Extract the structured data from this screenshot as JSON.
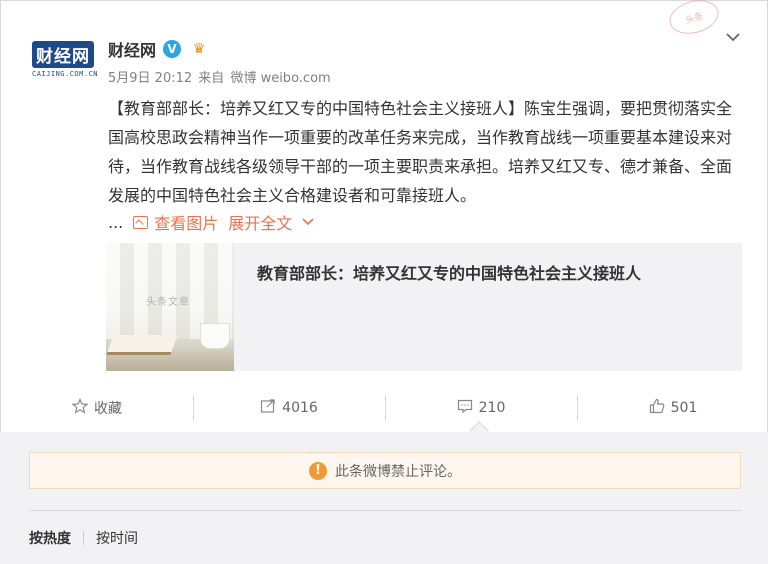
{
  "account": {
    "avatar_text": "财经网",
    "avatar_sub": "CAIJING.COM.CN",
    "name": "财经网",
    "verified_badge": "V",
    "vip_icon": "crown-icon"
  },
  "meta": {
    "date": "5月9日 20:12",
    "from": "来自",
    "source": "微博 weibo.com"
  },
  "stamp_text": "头条",
  "post": {
    "text": "【教育部部长：培养又红又专的中国特色社会主义接班人】陈宝生强调，要把贯彻落实全国高校思政会精神当作一项重要的改革任务来完成，当作教育战线一项重要基本建设来对待，当作教育战线各级领导干部的一项主要职责来承担。培养又红又专、德才兼备、全面发展的中国特色社会主义合格建设者和可靠接班人。",
    "ellipsis": "...",
    "view_image": "查看图片",
    "expand": "展开全文"
  },
  "preview": {
    "title": "教育部部长：培养又红又专的中国特色社会主义接班人",
    "watermark": "头条文章"
  },
  "actions": {
    "favorite": "收藏",
    "repost": "4016",
    "comment": "210",
    "like": "501"
  },
  "notice": {
    "text": "此条微博禁止评论。"
  },
  "sort": {
    "hot": "按热度",
    "time": "按时间"
  },
  "colors": {
    "accent_link": "#eb7350",
    "verified": "#2aa4e6",
    "notice_bg": "#fff6ee",
    "warning": "#f39a36"
  }
}
